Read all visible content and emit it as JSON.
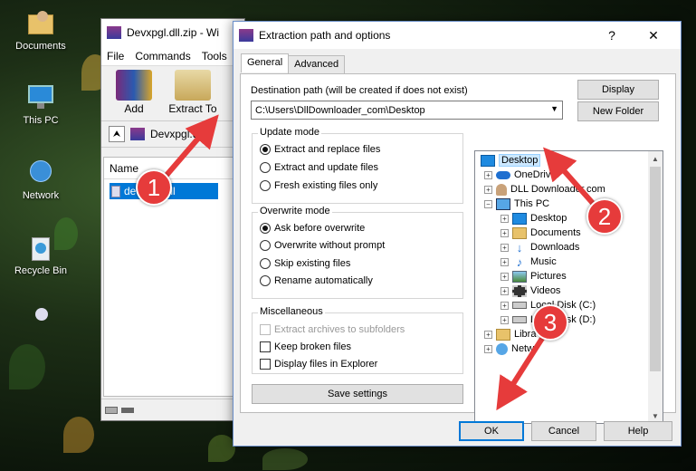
{
  "desktop": {
    "icons": [
      {
        "label": "Documents",
        "icon": "documents-folder-icon"
      },
      {
        "label": "This PC",
        "icon": "this-pc-icon"
      },
      {
        "label": "Network",
        "icon": "network-icon"
      },
      {
        "label": "Recycle Bin",
        "icon": "recycle-bin-icon"
      }
    ]
  },
  "rar_window": {
    "title": "Devxpgl.dll.zip - Wi",
    "menu": [
      "File",
      "Commands",
      "Tools"
    ],
    "toolbar": {
      "add_label": "Add",
      "extract_label": "Extract To"
    },
    "address": "Devxpgl.dll",
    "column_name": "Name",
    "file_name": "devxpgl.dll"
  },
  "dialog": {
    "title": "Extraction path and options",
    "help_glyph": "?",
    "close_glyph": "✕",
    "tabs": [
      "General",
      "Advanced"
    ],
    "dest_label": "Destination path (will be created if does not exist)",
    "dest_value": "C:\\Users\\DllDownloader_com\\Desktop",
    "display_button": "Display",
    "new_folder_button": "New Folder",
    "update_mode": {
      "title": "Update mode",
      "options": [
        "Extract and replace files",
        "Extract and update files",
        "Fresh existing files only"
      ],
      "selected": 0
    },
    "overwrite_mode": {
      "title": "Overwrite mode",
      "options": [
        "Ask before overwrite",
        "Overwrite without prompt",
        "Skip existing files",
        "Rename automatically"
      ],
      "selected": 0
    },
    "misc": {
      "title": "Miscellaneous",
      "options": [
        "Extract archives to subfolders",
        "Keep broken files",
        "Display files in Explorer"
      ]
    },
    "save_settings": "Save settings",
    "tree": [
      {
        "label": "Desktop",
        "icon": "desktop-icon"
      },
      {
        "label": "OneDrive",
        "icon": "onedrive-icon"
      },
      {
        "label": "DLL Downloader.com",
        "icon": "user-icon"
      },
      {
        "label": "This PC",
        "icon": "this-pc-icon"
      },
      {
        "label": "Desktop",
        "icon": "desktop-icon"
      },
      {
        "label": "Documents",
        "icon": "documents-icon"
      },
      {
        "label": "Downloads",
        "icon": "downloads-icon"
      },
      {
        "label": "Music",
        "icon": "music-icon"
      },
      {
        "label": "Pictures",
        "icon": "pictures-icon"
      },
      {
        "label": "Videos",
        "icon": "videos-icon"
      },
      {
        "label": "Local Disk (C:)",
        "icon": "disk-icon"
      },
      {
        "label": "Local Disk (D:)",
        "icon": "disk-icon"
      },
      {
        "label": "Libra",
        "icon": "libraries-icon"
      },
      {
        "label": "Netw",
        "icon": "network-icon"
      }
    ],
    "ok": "OK",
    "cancel": "Cancel",
    "help": "Help"
  },
  "annotations": {
    "step1": "1",
    "step2": "2",
    "step3": "3",
    "color": "#e63b3b"
  }
}
